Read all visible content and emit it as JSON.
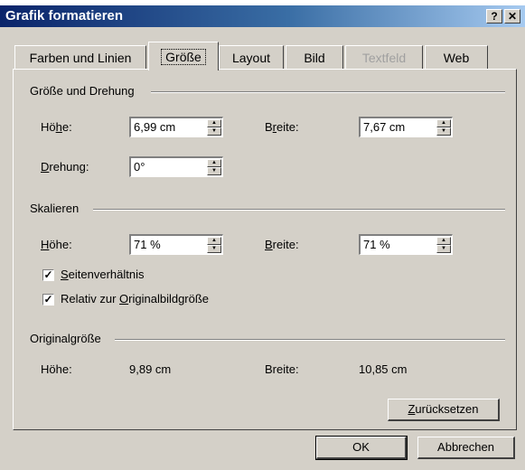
{
  "background_text": "…… ………… ……… … ……… … ………",
  "window": {
    "title": "Grafik formatieren",
    "help_label": "?",
    "close_label": "✕"
  },
  "tabs": [
    {
      "label": "Farben und Linien"
    },
    {
      "label": "Größe",
      "active": true
    },
    {
      "label": "Layout"
    },
    {
      "label": "Bild"
    },
    {
      "label": "Textfeld",
      "disabled": true
    },
    {
      "label": "Web"
    }
  ],
  "groups": {
    "size_rotation": {
      "title": "Größe und Drehung",
      "height_label_pre": "Hö",
      "height_label_ul": "h",
      "height_label_post": "e:",
      "height_value": "6,99 cm",
      "width_label_pre": "B",
      "width_label_ul": "r",
      "width_label_post": "eite:",
      "width_value": "7,67 cm",
      "rotation_label_pre": "",
      "rotation_label_ul": "D",
      "rotation_label_post": "rehung:",
      "rotation_value": "0°"
    },
    "scale": {
      "title": "Skalieren",
      "height_label_pre": "",
      "height_label_ul": "H",
      "height_label_post": "öhe:",
      "height_value": "71 %",
      "width_label_pre": "",
      "width_label_ul": "B",
      "width_label_post": "reite:",
      "width_value": "71 %",
      "aspect_label_pre": "",
      "aspect_label_ul": "S",
      "aspect_label_post": "eitenverhältnis",
      "aspect_checked": true,
      "relative_label_pre": "Relativ zur ",
      "relative_label_ul": "O",
      "relative_label_post": "riginalbildgröße",
      "relative_checked": true
    },
    "original": {
      "title": "Originalgröße",
      "height_label": "Höhe:",
      "height_value": "9,89 cm",
      "width_label": "Breite:",
      "width_value": "10,85 cm",
      "reset_pre": "",
      "reset_ul": "Z",
      "reset_post": "urücksetzen"
    }
  },
  "buttons": {
    "ok": "OK",
    "cancel": "Abbrechen"
  },
  "icons": {
    "spin_up": "up-arrow",
    "spin_down": "down-arrow",
    "check": "check-mark"
  },
  "colors": {
    "dialog_bg": "#d4d0c8",
    "title_start": "#0a246a",
    "title_end": "#a6caf0"
  }
}
